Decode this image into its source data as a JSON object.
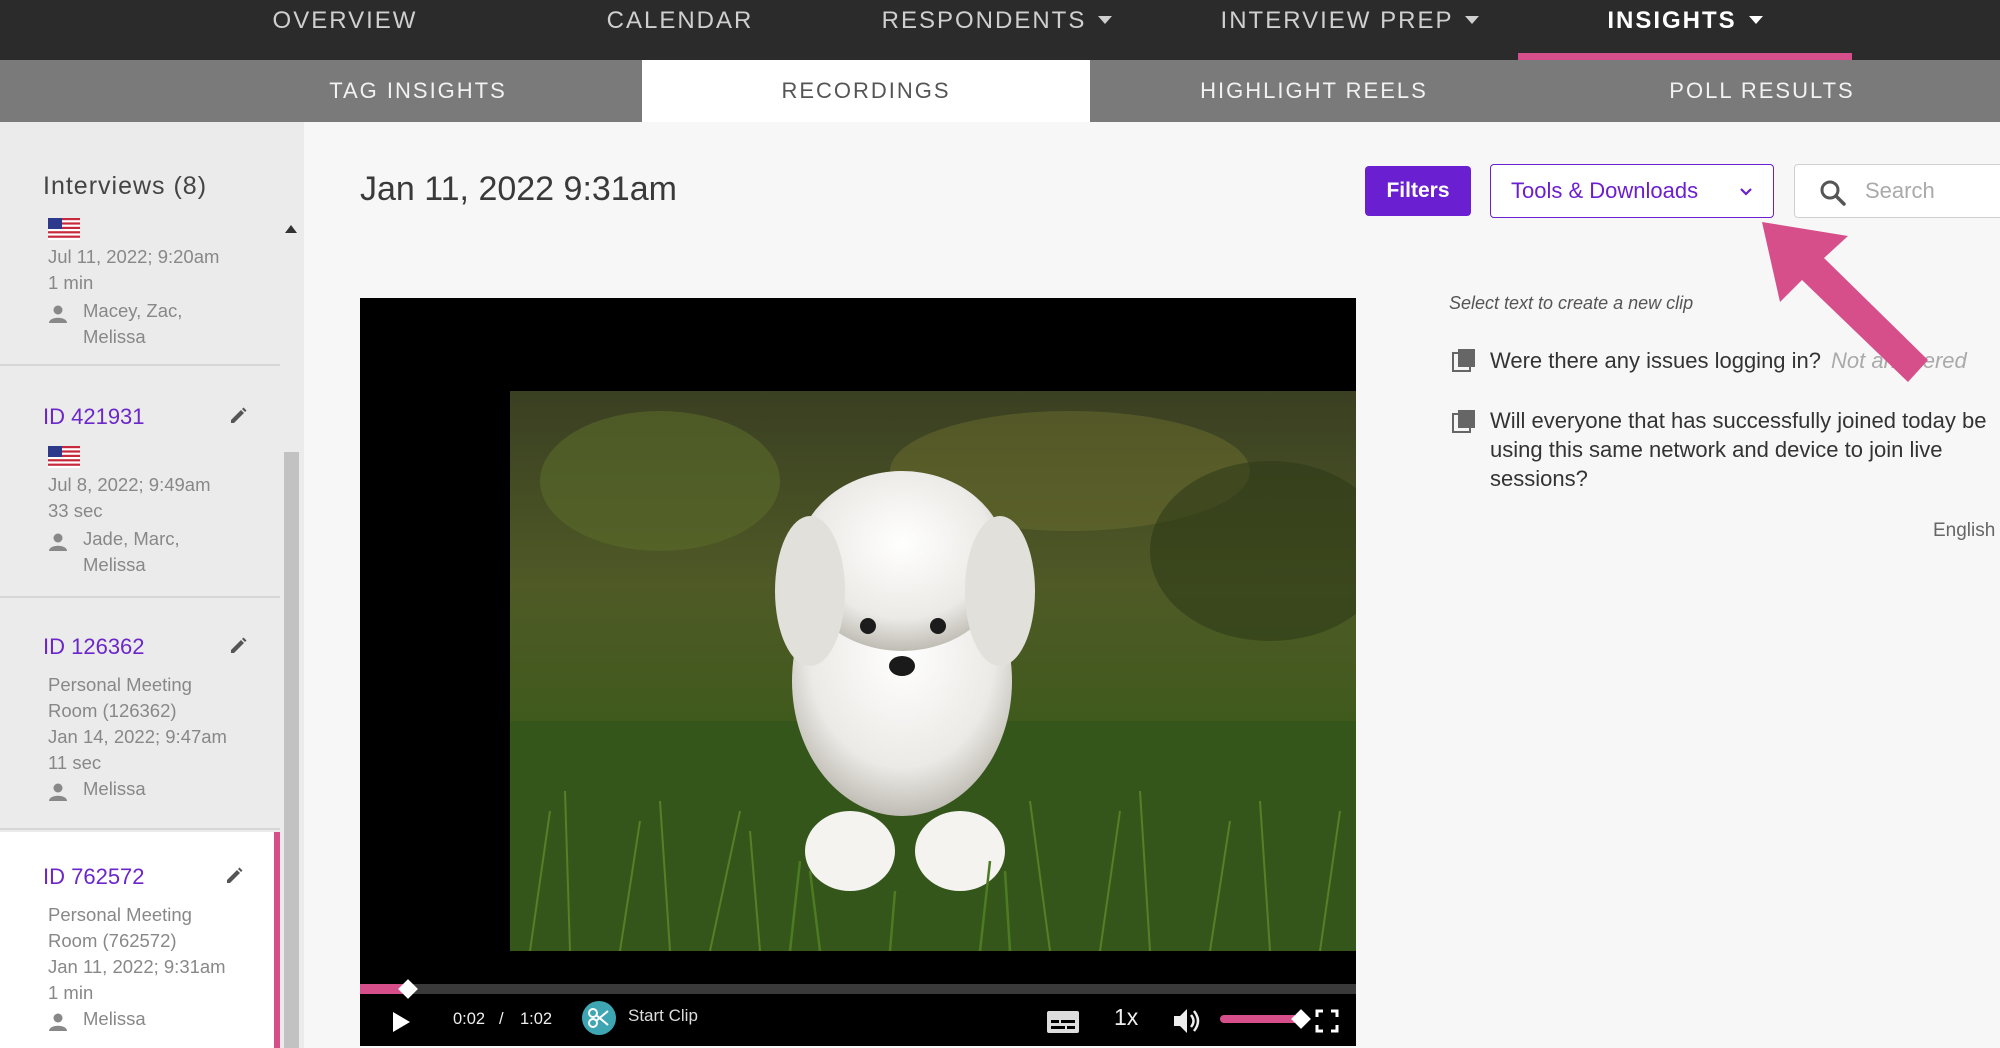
{
  "topnav": {
    "items": [
      {
        "label": "OVERVIEW"
      },
      {
        "label": "CALENDAR"
      },
      {
        "label": "RESPONDENTS"
      },
      {
        "label": "INTERVIEW PREP"
      },
      {
        "label": "INSIGHTS"
      }
    ],
    "active": "INSIGHTS"
  },
  "subnav": {
    "tabs": [
      {
        "label": "TAG INSIGHTS"
      },
      {
        "label": "RECORDINGS"
      },
      {
        "label": "HIGHLIGHT REELS"
      },
      {
        "label": "POLL RESULTS"
      }
    ],
    "active": "RECORDINGS"
  },
  "sidebar": {
    "heading": "Interviews (8)",
    "cards": [
      {
        "id": "",
        "date": "Jul 11, 2022; 9:20am",
        "duration": "1 min",
        "participants": [
          "Macey, Zac,",
          "Melissa"
        ],
        "flag": "us-flag"
      },
      {
        "id": "ID 421931",
        "date": "Jul 8, 2022; 9:49am",
        "duration": "33 sec",
        "participants": [
          "Jade, Marc,",
          "Melissa"
        ],
        "flag": "us-flag"
      },
      {
        "id": "ID 126362",
        "room": [
          "Personal Meeting",
          "Room (126362)"
        ],
        "date": "Jan 14, 2022; 9:47am",
        "duration": "11 sec",
        "participants": [
          "Melissa"
        ]
      },
      {
        "id": "ID 762572",
        "room": [
          "Personal Meeting",
          "Room (762572)"
        ],
        "date": "Jan 11, 2022; 9:31am",
        "duration": "1 min",
        "participants": [
          "Melissa"
        ]
      }
    ]
  },
  "main": {
    "title": "Jan 11, 2022 9:31am",
    "filters_label": "Filters",
    "tools_label": "Tools & Downloads",
    "search_placeholder": "Search"
  },
  "player": {
    "current_time": "0:02",
    "separator": "/",
    "total_time": "1:02",
    "start_clip_label": "Start Clip",
    "speed": "1x",
    "progress_fraction": 0.048
  },
  "transcript": {
    "hint": "Select text to create a new clip",
    "questions": [
      {
        "text": "Were there any issues logging in?",
        "status": "Not answered"
      },
      {
        "text": "Will everyone that has successfully joined today be using this same network and device to join live sessions?"
      }
    ],
    "language": "English"
  },
  "colors": {
    "accent_purple": "#6a1fd0",
    "accent_pink": "#d64f8a",
    "nav_dark": "#2b2b2b",
    "subnav_gray": "#7a7a7a"
  },
  "icons": [
    "caret-down-icon",
    "edit-pencil-icon",
    "person-icon",
    "us-flag-icon",
    "search-icon",
    "chevron-down-icon",
    "play-icon",
    "scissors-icon",
    "captions-icon",
    "volume-icon",
    "fullscreen-icon",
    "copy-clip-icon"
  ]
}
